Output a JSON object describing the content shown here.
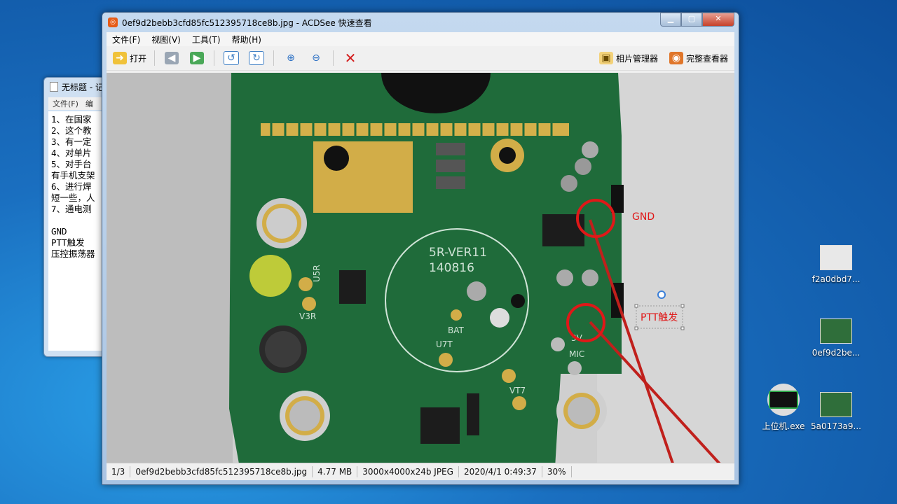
{
  "notepad": {
    "title": "无标题 - 记",
    "menu": [
      "文件(F)",
      "编"
    ],
    "body": "1、在国家\n2、这个教\n3、有一定\n4、对单片\n5、对手台\n有手机支架\n6、进行焊\n短一些，人\n7、通电测\n\nGND\nPTT触发\n压控振荡器"
  },
  "desktop_icons": [
    {
      "label": "f2a0dbd7..."
    },
    {
      "label": "0ef9d2be..."
    },
    {
      "label": "上位机.exe"
    },
    {
      "label": "5a0173a9..."
    }
  ],
  "window": {
    "title": "0ef9d2bebb3cfd85fc512395718ce8b.jpg - ACDSee 快速查看",
    "menu": [
      "文件(F)",
      "视图(V)",
      "工具(T)",
      "帮助(H)"
    ],
    "toolbar": {
      "open": "打开",
      "photo_manager": "相片管理器",
      "full_viewer": "完整查看器"
    },
    "annotations": {
      "gnd": "GND",
      "ptt": "PTT触发"
    },
    "pcb_silk": {
      "ver": "5R-VER11",
      "code": "140816",
      "bat": "BAT",
      "u7t": "U7T",
      "v3r": "V3R",
      "u5r": "U5R",
      "vt7": "VT7",
      "mic": "MIC",
      "v3": "3V"
    },
    "status": {
      "index": "1/3",
      "file": "0ef9d2bebb3cfd85fc512395718ce8b.jpg",
      "size": "4.77 MB",
      "dims": "3000x4000x24b JPEG",
      "date": "2020/4/1 0:49:37",
      "zoom": "30%"
    }
  }
}
